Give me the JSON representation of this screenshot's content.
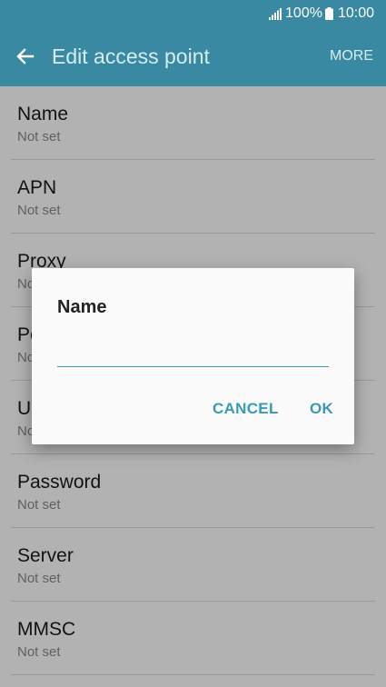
{
  "status_bar": {
    "battery": "100%",
    "time": "10:00",
    "icons": [
      "signal-icon",
      "battery-icon"
    ]
  },
  "app_bar": {
    "title": "Edit access point",
    "more_label": "MORE",
    "back_icon": "back-arrow-icon"
  },
  "settings": {
    "items": [
      {
        "label": "Name",
        "value": "Not set"
      },
      {
        "label": "APN",
        "value": "Not set"
      },
      {
        "label": "Proxy",
        "value": "Not set"
      },
      {
        "label": "Port",
        "value": "Not set"
      },
      {
        "label": "Username",
        "value": "Not set"
      },
      {
        "label": "Password",
        "value": "Not set"
      },
      {
        "label": "Server",
        "value": "Not set"
      },
      {
        "label": "MMSC",
        "value": "Not set"
      }
    ]
  },
  "dialog": {
    "title": "Name",
    "input_value": "",
    "cancel_label": "CANCEL",
    "ok_label": "OK"
  },
  "colors": {
    "app_bar": "#3a89a3",
    "accent": "#3a9ab5",
    "scrim": "rgba(0,0,0,0.3)"
  }
}
